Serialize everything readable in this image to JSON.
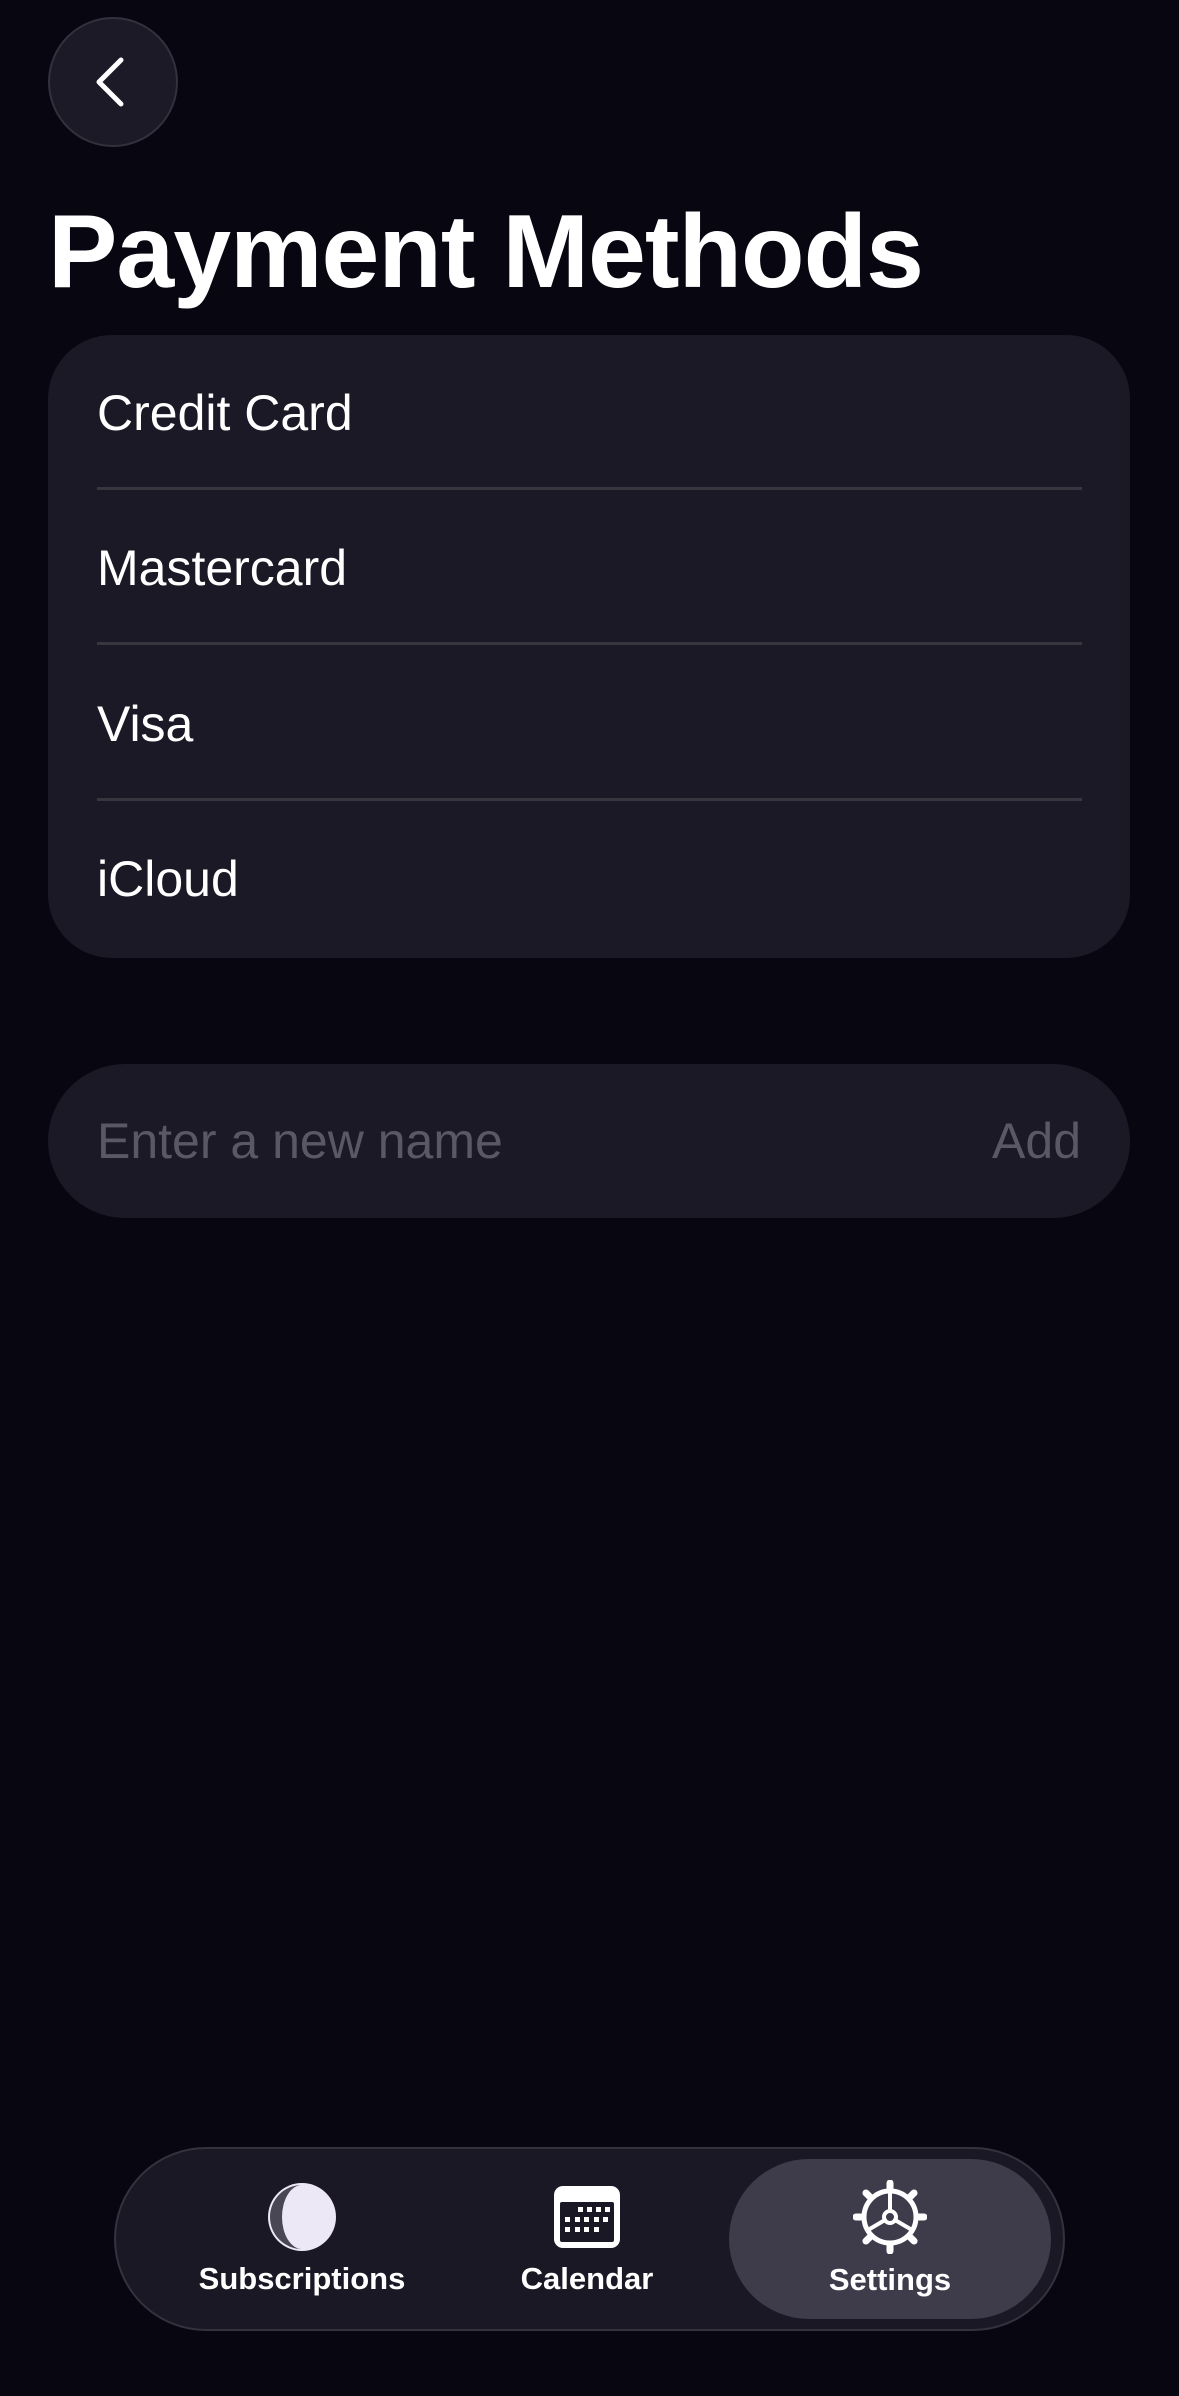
{
  "header": {
    "back_icon": "chevron-left-icon",
    "title": "Payment Methods"
  },
  "methods": [
    {
      "label": "Credit Card"
    },
    {
      "label": "Mastercard"
    },
    {
      "label": "Visa"
    },
    {
      "label": "iCloud"
    }
  ],
  "add_form": {
    "placeholder": "Enter a new name",
    "value": "",
    "add_label": "Add"
  },
  "tabs": [
    {
      "label": "Subscriptions",
      "icon": "half-moon-icon",
      "active": false
    },
    {
      "label": "Calendar",
      "icon": "calendar-icon",
      "active": false
    },
    {
      "label": "Settings",
      "icon": "gear-icon",
      "active": true
    }
  ],
  "colors": {
    "background": "#080610",
    "card": "#1b1925",
    "divider": "#38353f",
    "placeholder": "#5b5866",
    "active_tab": "#3e3b4a"
  }
}
